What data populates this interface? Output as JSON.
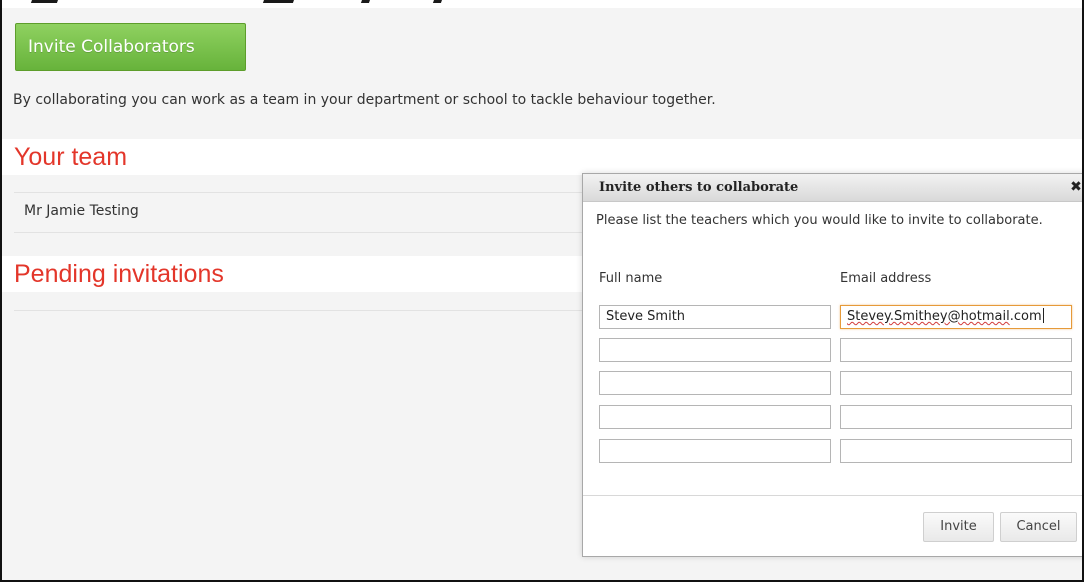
{
  "header": {
    "invite_button_label": "Invite Collaborators"
  },
  "intro_text": "By collaborating you can work as a team in your department or school to tackle behaviour together.",
  "team": {
    "heading": "Your team",
    "members": [
      "Mr Jamie Testing"
    ]
  },
  "pending": {
    "heading": "Pending invitations"
  },
  "dialog": {
    "title": "Invite others to collaborate",
    "close_icon": "close-icon",
    "description": "Please list the teachers which you would like to invite to collaborate.",
    "full_name_label": "Full name",
    "email_label": "Email address",
    "rows": [
      {
        "name": "Steve Smith",
        "email_user": "Stevey.Smithey@hotmail",
        "email_tld": ".com"
      },
      {
        "name": "",
        "email_user": "",
        "email_tld": ""
      },
      {
        "name": "",
        "email_user": "",
        "email_tld": ""
      },
      {
        "name": "",
        "email_user": "",
        "email_tld": ""
      },
      {
        "name": "",
        "email_user": "",
        "email_tld": ""
      }
    ],
    "invite_label": "Invite",
    "cancel_label": "Cancel"
  },
  "colors": {
    "accent_green": "#67b33b",
    "heading_red": "#e3362a",
    "focus_orange": "#e69a3a"
  }
}
